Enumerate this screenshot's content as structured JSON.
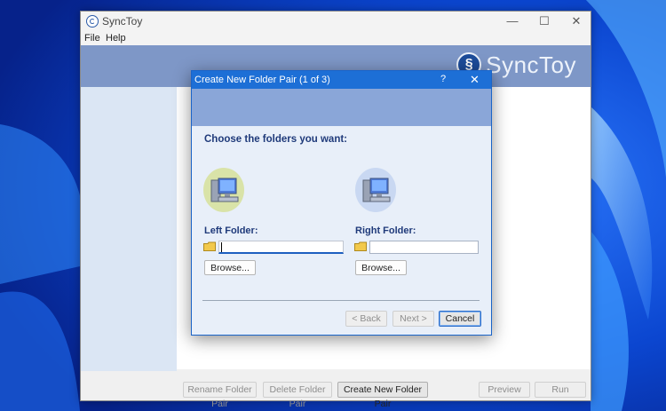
{
  "app": {
    "title": "SyncToy",
    "brand": "SyncToy",
    "window_controls": [
      "—",
      "☐",
      "✕"
    ]
  },
  "menu": [
    "File",
    "Help"
  ],
  "dialog": {
    "title": "Create New Folder Pair (1 of 3)",
    "help": "?",
    "close": "✕",
    "heading": "Choose the folders you want:",
    "left_label": "Left Folder:",
    "right_label": "Right Folder:",
    "left_value": "",
    "right_value": "",
    "browse_left": "Browse...",
    "browse_right": "Browse...",
    "back": "< Back",
    "next": "Next >",
    "cancel": "Cancel"
  },
  "bottom_buttons": {
    "rename": "Rename Folder Pair",
    "delete": "Delete Folder Pair",
    "create": "Create New Folder Pair",
    "preview": "Preview",
    "run": "Run"
  },
  "icons": {
    "app": "synctoy-logo-icon",
    "computer": "computer-icon",
    "folder": "folder-icon"
  },
  "colors": {
    "dialog_titlebar": "#1d6fd6",
    "header_band": "#7e97c7",
    "heading_text": "#1f3a7a"
  }
}
